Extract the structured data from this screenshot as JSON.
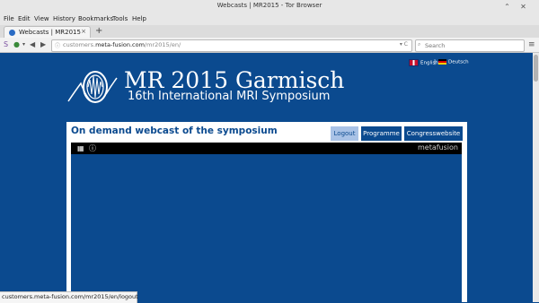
{
  "window": {
    "title": "Webcasts | MR2015 - Tor Browser",
    "controls": [
      "chevron-up-icon",
      "close-icon"
    ]
  },
  "menu": [
    "File",
    "Edit",
    "View",
    "History",
    "Bookmarks",
    "Tools",
    "Help"
  ],
  "tab": {
    "label": "Webcasts | MR2015",
    "close": "×",
    "new_tab": "+"
  },
  "nav": {
    "url_host": "customers.meta-fusion.com",
    "url_path": "/mr2015/en/",
    "url_prefix": "customers.",
    "url_domain": "meta-fusion.com",
    "search_placeholder": "Search",
    "url_controls": "▾ C"
  },
  "header": {
    "conference_title": "MR 2015 Garmisch",
    "conference_subtitle": "16th International MRI Symposium",
    "lang_english": "English",
    "lang_german": "Deutsch",
    "lang_separator": "|"
  },
  "panel": {
    "title": "On demand webcast of the symposium",
    "buttons": [
      "Logout",
      "Programme",
      "Congresswebsite"
    ],
    "active_button": "Logout",
    "player_brand": "metafusion"
  },
  "status": {
    "url": "customers.meta-fusion.com/mr2015/en/logout"
  },
  "colors": {
    "brand_blue": "#0b4a8f",
    "active_tab": "#a9c2e6"
  }
}
